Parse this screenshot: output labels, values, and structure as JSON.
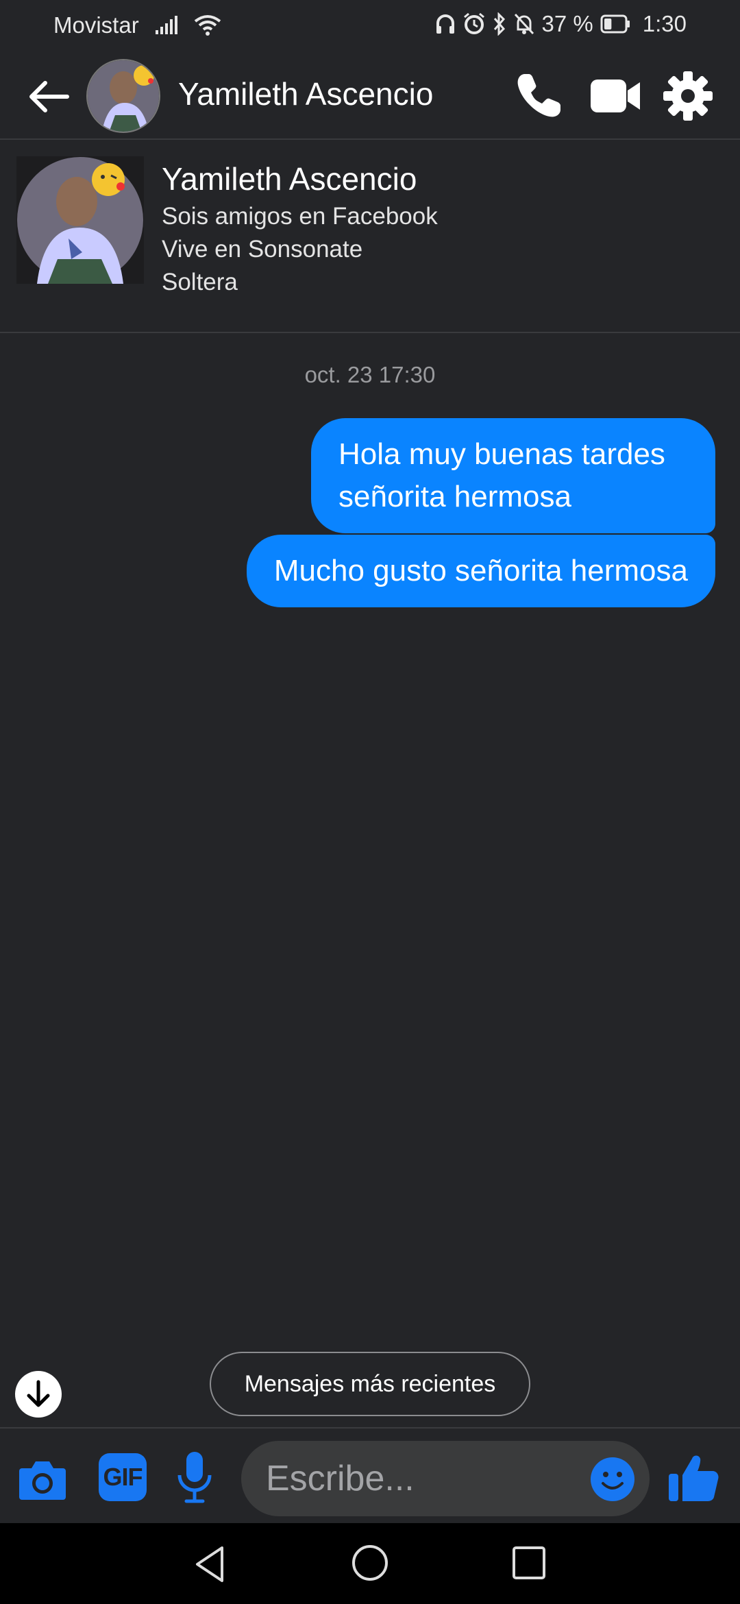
{
  "status_bar": {
    "carrier": "Movistar",
    "battery_percent": "37 %",
    "battery_level": 0.37,
    "time": "1:30"
  },
  "header": {
    "contact_name": "Yamileth Ascencio"
  },
  "profile": {
    "name": "Yamileth Ascencio",
    "friends_line": "Sois amigos en Facebook",
    "location_line": "Vive en Sonsonate",
    "status_line": "Soltera"
  },
  "conversation": {
    "timestamp": "oct. 23 17:30",
    "messages": [
      {
        "text": "Hola muy buenas tardes señorita hermosa",
        "sender": "me"
      },
      {
        "text": "Mucho gusto señorita hermosa",
        "sender": "me"
      }
    ]
  },
  "recent_pill": {
    "label": "Mensajes más recientes"
  },
  "composer": {
    "gif_label": "GIF",
    "placeholder": "Escribe..."
  },
  "colors": {
    "background": "#242528",
    "bubble": "#0a84ff",
    "accent": "#1877f2"
  },
  "icons": [
    "back-arrow-icon",
    "phone-icon",
    "video-camera-icon",
    "gear-icon",
    "arrow-down-icon",
    "camera-icon",
    "microphone-icon",
    "emoji-icon",
    "thumbs-up-icon"
  ]
}
